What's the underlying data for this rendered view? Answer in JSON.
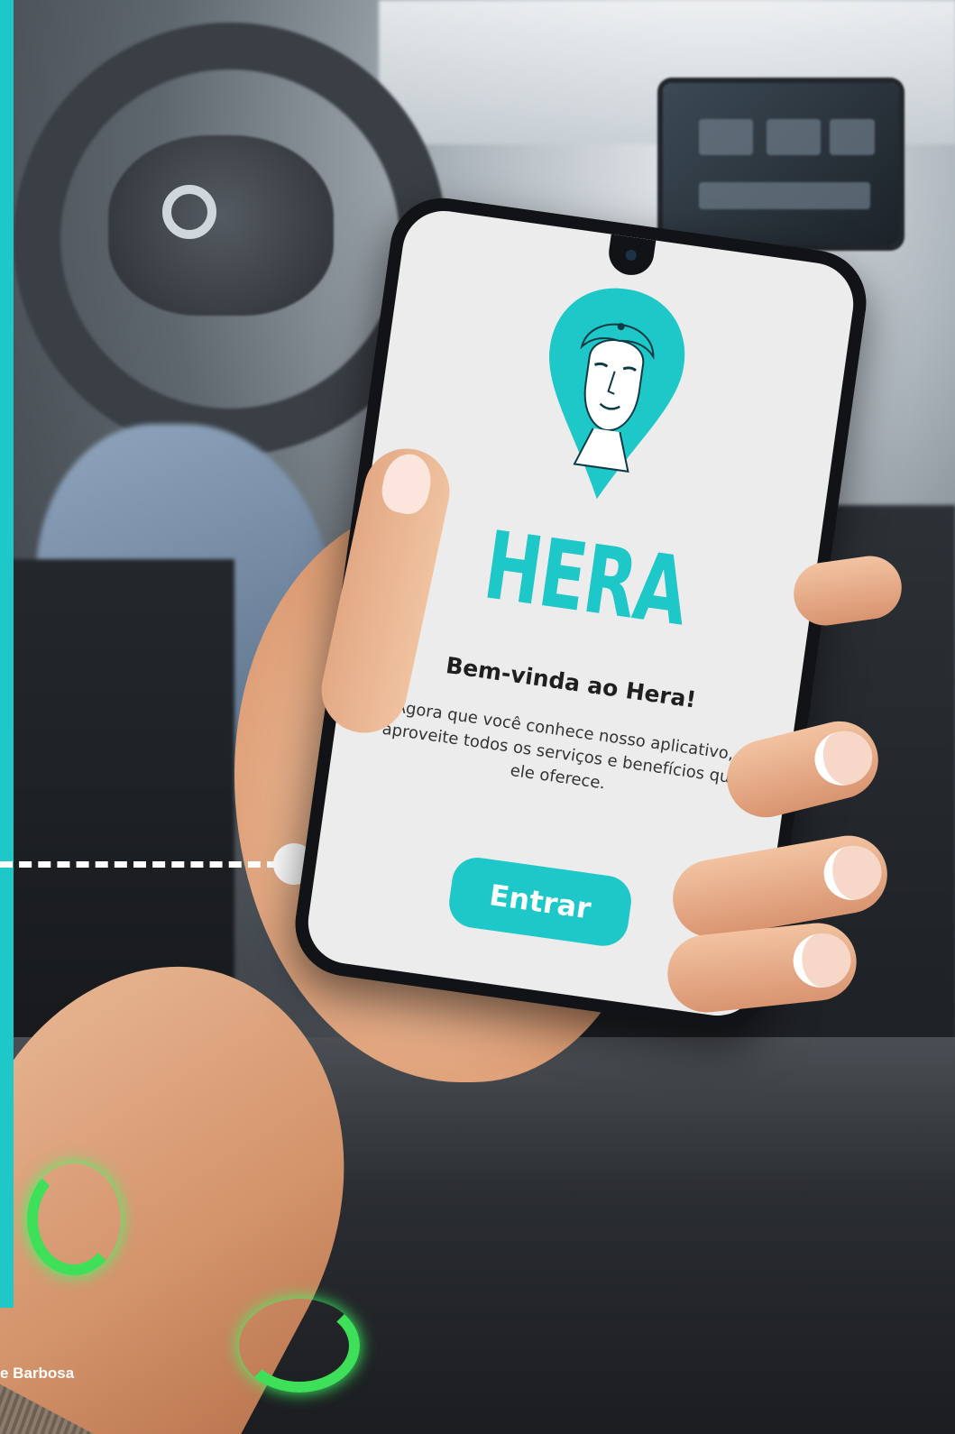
{
  "app": {
    "brand": "HERA",
    "welcome_title": "Bem-vinda ao Hera!",
    "welcome_text": "Agora que você conhece nosso aplicativo, aproveite todos os serviços e benefícios que ele oferece.",
    "enter_label": "Entrar",
    "logo_icon": "woman-face-location-pin-icon"
  },
  "credit": "e Barbosa",
  "colors": {
    "accent": "#1ec7c8",
    "screen_bg": "#ececec",
    "title_text": "#1f1f1f",
    "body_text": "#333333",
    "button_text": "#ffffff"
  }
}
